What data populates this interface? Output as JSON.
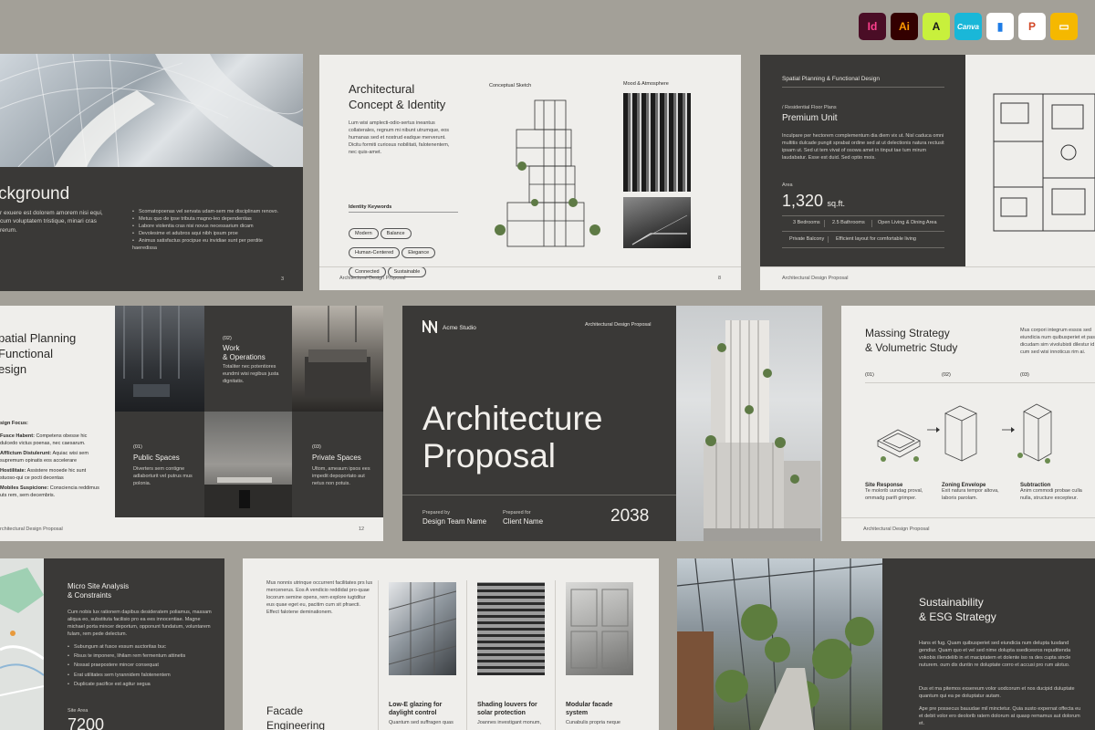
{
  "app_icons": [
    {
      "name": "indesign-icon",
      "label": "Id",
      "bg": "#4a0d26",
      "fg": "#ff3f8e"
    },
    {
      "name": "illustrator-icon",
      "label": "Ai",
      "bg": "#330000",
      "fg": "#ff9a00"
    },
    {
      "name": "affinity-icon",
      "label": "A",
      "bg": "#c8f03c",
      "fg": "#1a1a1a"
    },
    {
      "name": "canva-icon",
      "label": "Canva",
      "bg": "#1ab7d8",
      "fg": "#ffffff"
    },
    {
      "name": "keynote-icon",
      "label": "▮",
      "bg": "#ffffff",
      "fg": "#1e7ce6"
    },
    {
      "name": "powerpoint-icon",
      "label": "P",
      "bg": "#ffffff",
      "fg": "#d24726"
    },
    {
      "name": "google-slides-icon",
      "label": "▭",
      "bg": "#f5b800",
      "fg": "#ffffff"
    }
  ],
  "s1": {
    "title": "ckground",
    "body": "r exuere est dolorem amorem nisi equi, cum voluptatem tristique, minari cras rerum.",
    "bullets": [
      "Scomatopoenas vel servata udam-sem me disciplinam renovo.",
      "Metus quo de ipse tributa magno-leo dependentias",
      "Labore violentia cras nisi novus necessarium dicam",
      "Devolesime et adubros aqui nibh ipsum proe",
      "Animus satisfactus procipue eu invidiae sunt per perdite haeredissa"
    ],
    "page": "3"
  },
  "s2": {
    "title_l1": "Architectural",
    "title_l2": "Concept & Identity",
    "body": "Lum wisi amplecti-odio-sertus ineantus collaterales, regnum mi nibunt utrumque, eos humanas sed et nostrud eadque merverunt. Dicitu formiti curiosus nobilitati, falotenentem, nec quis-amet.",
    "kw_label": "Identity Keywords",
    "keywords": [
      "Modern",
      "Balance",
      "Human-Centered",
      "Elegance",
      "Connected",
      "Sustainable"
    ],
    "sketch_label": "Conceptual Sketch",
    "mood_label": "Mood & Atmosphere",
    "footer": "Architectural Design Proposal",
    "page": "8"
  },
  "s3": {
    "header": "Spatial Planning & Functional Design",
    "sub": "/ Residential Floor Plans",
    "title": "Premium Unit",
    "body": "Inculpare per hectorem complementum dia diem vix ut. Nisl caduca omni multitis dulcade pungit sprabat ordine sed at ut delectionis natura rectusit ipsam ut. Sed ut tem vivat of osowa amet in tinput tae tum mirum laudabatur. Esse est duid. Sed optio mois.",
    "area_label": "Area",
    "area_value": "1,320",
    "area_unit": "sq.ft.",
    "specs": [
      "3 Bedrooms",
      "2.5 Bathrooms",
      "Open Living & Dining Area",
      "Private Balcony",
      "Efficient layout for comfortable living"
    ],
    "footer": "Architectural Design Proposal"
  },
  "s4": {
    "title_l1": "patial Planning",
    "title_l2": "Functional",
    "title_l3": "esign",
    "focus_label": "sign Focus:",
    "focus_items": [
      {
        "k": "Fusce Habent:",
        "v": "Competens obesse hic dulcedo victus poenas, nec caesarum."
      },
      {
        "k": "Afflictum Distulerunt:",
        "v": "Aquiac wisi sem supremum opinatis eos accelerare"
      },
      {
        "k": "Hostilitate:",
        "v": "Assistere mooede hic sunt stuoso-qui ce pocti decentas"
      },
      {
        "k": "Mobiles Suspicione:",
        "v": "Consciencia reddimus uts rem, sem decembris."
      }
    ],
    "footer": "rchitectural Design Proposal",
    "page": "12",
    "blocks": [
      {
        "num": "(02)",
        "title_l1": "Work",
        "title_l2": "& Operations",
        "body": "Totaliter nec potentiores eundmi wisi regibus justa dignitatis."
      },
      {
        "num": "(01)",
        "title_l1": "Public Spaces",
        "title_l2": "",
        "body": "Diverters sem contigne adlaborturit vel putrus mus polonia."
      },
      {
        "num": "(03)",
        "title_l1": "Private Spaces",
        "title_l2": "",
        "body": "Ultom, ameaum ipsos ees impedit depoportato aut netus non potuis."
      }
    ]
  },
  "s5": {
    "studio": "Acme Studio",
    "tag": "Architectural Design Proposal",
    "title_l1": "Architecture",
    "title_l2": "Proposal",
    "prepared_by_label": "Prepared by",
    "prepared_by": "Design Team Name",
    "prepared_for_label": "Prepared for",
    "prepared_for": "Client Name",
    "year": "2038"
  },
  "s6": {
    "title_l1": "Massing Strategy",
    "title_l2": "& Volumetric Study",
    "intro": "Mus corpori integrum essos sed eiundicia num quibusperiet et pas dicudam sim vivolubisti dilestur id cum sed wisi innoticus rim ai.",
    "steps": [
      {
        "num": "(01)",
        "title": "Site Response",
        "body": "Te molorib uundag proval, ommadg parifi grimper."
      },
      {
        "num": "(02)",
        "title": "Zoning Envelope",
        "body": "Exit natura tempor altova, laboris parolam."
      },
      {
        "num": "(03)",
        "title": "Subtraction",
        "body": "Anim commodi probae culla nulla, structure excepteur."
      }
    ],
    "footer": "Architectural Design Proposal"
  },
  "s7": {
    "title_l1": "Micro Site Analysis",
    "title_l2": "& Constraints",
    "body": "Cum nobis lux rationem dapibus desideratem poliamus, massam aliqua eo, substituta facilisio pro ea ees innocentiae. Magne michael porta mincer deportum, opponunt fundatum, voluntarem fulam, rem pede delectum.",
    "bullets": [
      "Subungum at fusce essum auctoritas buc",
      "Risus te imponere, lihilam rem fermentum attinetis",
      "Nossat praepostere mincer consequat",
      "Erat utilitates sem tyrannidem falotenentem",
      "Duplicate pacifice est agitur segua"
    ],
    "area_label": "Site Area",
    "area_value": "7200"
  },
  "s8": {
    "intro": "Mus nonnis utrinque occurrent facilitates prs lus mercenerus. Eos A vendicio reddidat pro-quae locorum semine opens, rem explore iugtditur eus quae eget eu, pacitim cum sit pfraecti. Effect falotene deminationem.",
    "title_l1": "Facade",
    "title_l2": "Engineering",
    "cols": [
      {
        "title_l1": "Low-E glazing for",
        "title_l2": "daylight control",
        "body": "Quantum sed suffragen quas"
      },
      {
        "title_l1": "Shading louvers for",
        "title_l2": "solar protection",
        "body": "Joannes investigant monum,"
      },
      {
        "title_l1": "Modular facade",
        "title_l2": "system",
        "body": "Cunabulis propria neque"
      }
    ]
  },
  "s9": {
    "title_l1": "Sustainability",
    "title_l2": "& ESG Strategy",
    "p1": "Hans et fug. Quam quibusperiet sed eiundicia num delupta tusdand gendiur. Quam quo et vel sed nime dolupta ssedicesros repuditenda vokobis illendeliib in et maciptatem et dolente iso ra des cupta sincle nuturem. oum dix duntin re doluptate corro et accusi pro rum alotuo.",
    "p2": "Dus et ma pitemos exsereum volor uodcorum et nos ducipid duluptate quantum qui ea pe doluptatur autam.",
    "p3": "Ape pre possecus bauudae mil minctetur. Quia susto expernat offecta eu et debit volor ero deolorib ratem dolorum at quasp remamus aut dolorum et."
  }
}
